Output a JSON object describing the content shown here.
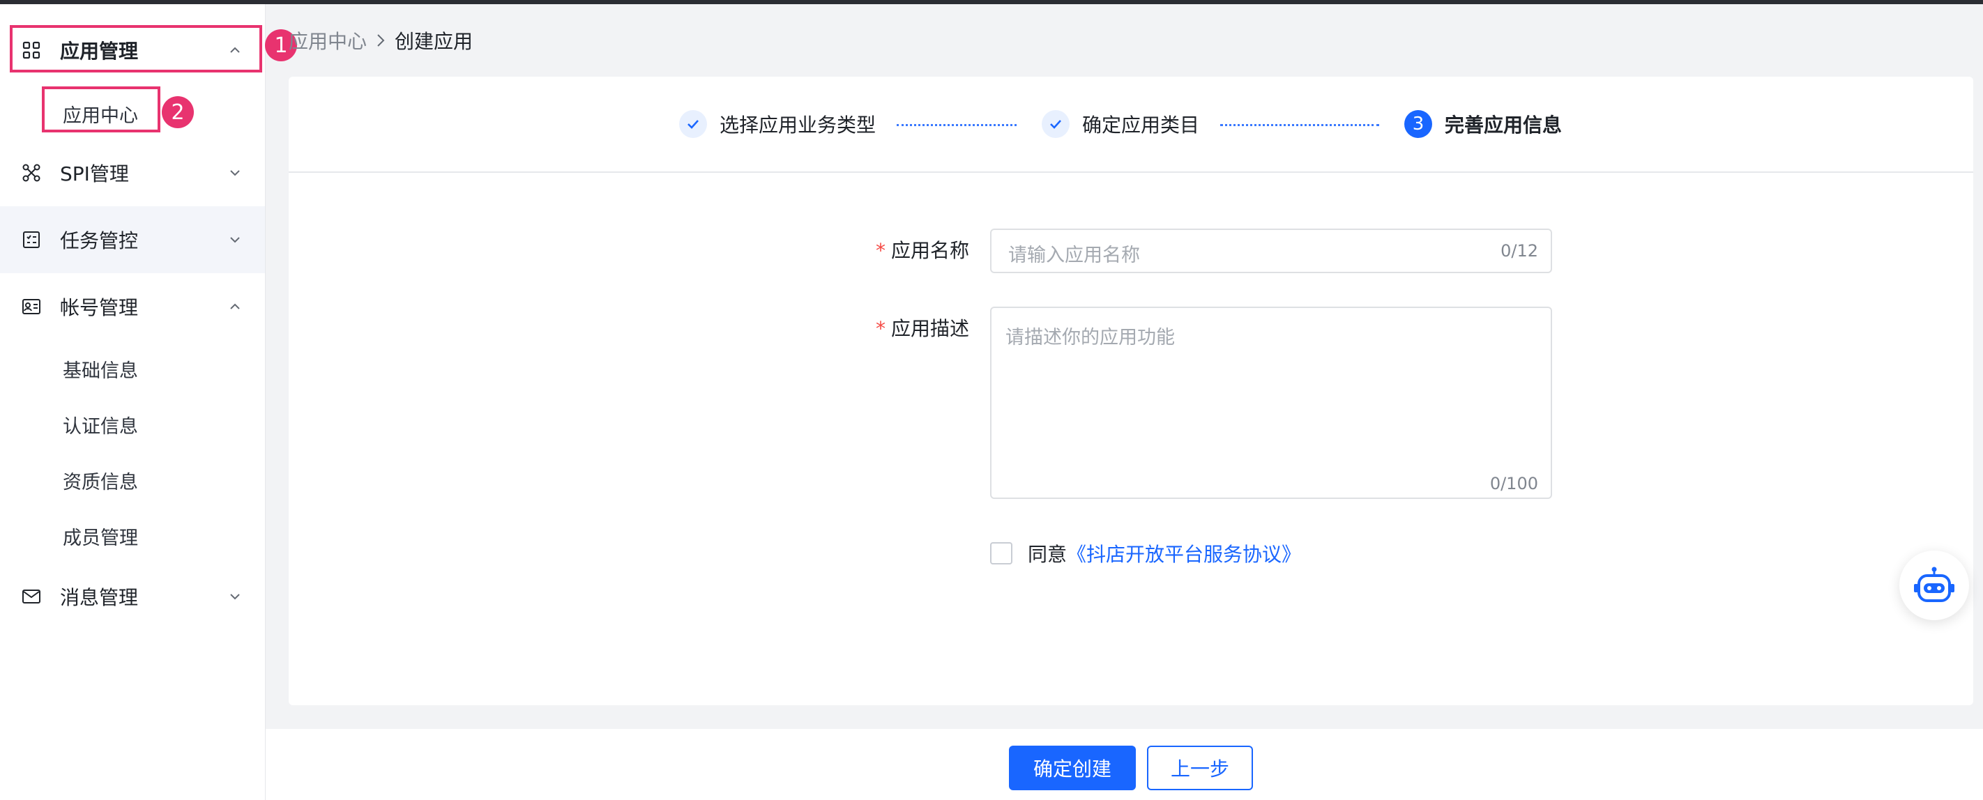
{
  "sidebar": {
    "items": [
      {
        "label": "应用管理",
        "icon": "apps-grid-icon",
        "arrow": "chevron-up-icon"
      },
      {
        "label": "SPI管理",
        "icon": "spi-nodes-icon",
        "arrow": "chevron-down-icon"
      },
      {
        "label": "任务管控",
        "icon": "task-list-icon",
        "arrow": "chevron-down-icon"
      },
      {
        "label": "帐号管理",
        "icon": "id-card-icon",
        "arrow": "chevron-up-icon"
      },
      {
        "label": "消息管理",
        "icon": "mail-icon",
        "arrow": "chevron-down-icon"
      }
    ],
    "app_sub": [
      "应用中心"
    ],
    "account_sub": [
      "基础信息",
      "认证信息",
      "资质信息",
      "成员管理"
    ]
  },
  "annotations": {
    "badge1": "1",
    "badge2": "2",
    "color": "#e8336f"
  },
  "breadcrumb": {
    "parent": "应用中心",
    "separator_icon": "chevron-right-icon",
    "current": "创建应用"
  },
  "steps": [
    {
      "label": "选择应用业务类型",
      "status": "done",
      "icon": "check-icon"
    },
    {
      "label": "确定应用类目",
      "status": "done",
      "icon": "check-icon"
    },
    {
      "label": "完善应用信息",
      "status": "current",
      "number": "3"
    }
  ],
  "form": {
    "name": {
      "label": "应用名称",
      "required_mark": "*",
      "placeholder": "请输入应用名称",
      "counter": "0/12"
    },
    "description": {
      "label": "应用描述",
      "required_mark": "*",
      "placeholder": "请描述你的应用功能",
      "counter": "0/100"
    },
    "agreement": {
      "prefix": "同意",
      "link": "《抖店开放平台服务协议》",
      "checked": false
    }
  },
  "assistant": {
    "icon": "robot-icon"
  },
  "footer": {
    "confirm": "确定创建",
    "back": "上一步"
  },
  "colors": {
    "primary": "#1966ff",
    "required": "#f54a45",
    "highlight": "#e8336f"
  }
}
